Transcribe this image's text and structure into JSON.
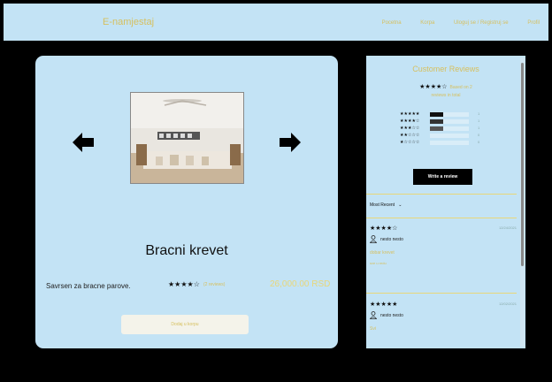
{
  "navbar": {
    "brand": "E-namjestaj",
    "links": [
      "Pocetna",
      "Korpa",
      "Uloguj se / Registruj se",
      "Profil"
    ]
  },
  "product": {
    "title": "Bracni krevet",
    "description": "Savrsen za bracne parove.",
    "stars": "★★★★☆",
    "rating_count": "(2 reviews)",
    "price": "26,000.00 RSD",
    "add_to_cart_label": "Dodaj u korpu"
  },
  "reviews": {
    "title": "Customer Reviews",
    "overall_stars": "★★★★☆",
    "overall_count": "Based on 2",
    "overall_sub": "reviews in total",
    "breakdown": [
      {
        "stars": "★★★★★",
        "fraction": 0.35,
        "count": "1"
      },
      {
        "stars": "★★★★☆",
        "fraction": 0.35,
        "count": "1"
      },
      {
        "stars": "★★★☆☆",
        "fraction": 0.35,
        "count": "1"
      },
      {
        "stars": "★★☆☆☆",
        "fraction": 0,
        "count": "0"
      },
      {
        "stars": "★☆☆☆☆",
        "fraction": 0,
        "count": "0"
      }
    ],
    "write_label": "Write a review",
    "sort_label": "Most Recent",
    "items": [
      {
        "stars": "★★★★☆",
        "date": "12/24/2021",
        "user": "nesto nesto",
        "heading": "dobar krevet",
        "body": "sve u redu"
      },
      {
        "stars": "★★★★★",
        "date": "12/02/2021",
        "user": "nesto nesto",
        "heading": "Svi",
        "body": ""
      }
    ]
  },
  "colors": {
    "accent": "#d6c060",
    "panel": "#c3e3f5",
    "background": "#000000"
  }
}
